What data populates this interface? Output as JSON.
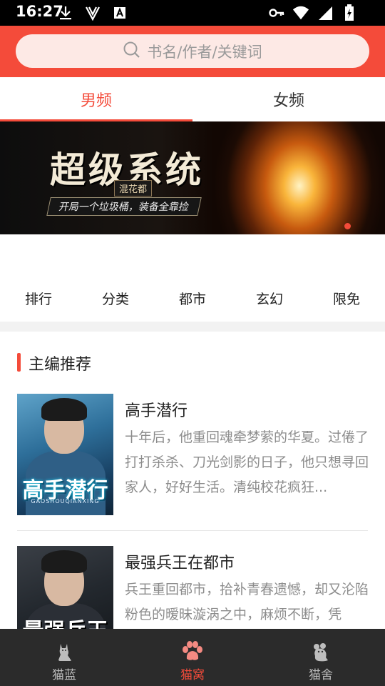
{
  "status_bar": {
    "time": "16:27",
    "icons": [
      "download-icon",
      "v-icon",
      "a-box-icon",
      "key-icon",
      "wifi-icon",
      "signal-icon",
      "battery-icon"
    ]
  },
  "search": {
    "placeholder": "书名/作者/关键词",
    "icon": "search-icon",
    "accent": "#f44b3a"
  },
  "tabs": [
    {
      "label": "男频",
      "active": true
    },
    {
      "label": "女频",
      "active": false
    }
  ],
  "banner": {
    "title": "超级系统",
    "badge": "混花都",
    "subtitle": "开局一个垃圾桶，装备全靠捡"
  },
  "categories": [
    "排行",
    "分类",
    "都市",
    "玄幻",
    "限免"
  ],
  "section": {
    "title": "主编推荐",
    "books": [
      {
        "title": "高手潜行",
        "cover_text": "高手潜行",
        "cover_pinyin": "GAOSHOUQIANXING",
        "description": "十年后，他重回魂牵梦萦的华夏。过倦了打打杀杀、刀光剑影的日子，他只想寻回家人，好好生活。清纯校花疯狂..."
      },
      {
        "title": "最强兵王在都市",
        "cover_text": "最强兵王",
        "description": "兵王重回都市，拾补青春遗憾，却又沦陷粉色的暧昧漩涡之中，麻烦不断，凭"
      }
    ]
  },
  "bottom_nav": [
    {
      "label": "猫蓝",
      "icon": "cat-icon",
      "active": false
    },
    {
      "label": "猫窝",
      "icon": "paw-icon",
      "active": true
    },
    {
      "label": "猫舍",
      "icon": "mouse-icon",
      "active": false
    }
  ]
}
